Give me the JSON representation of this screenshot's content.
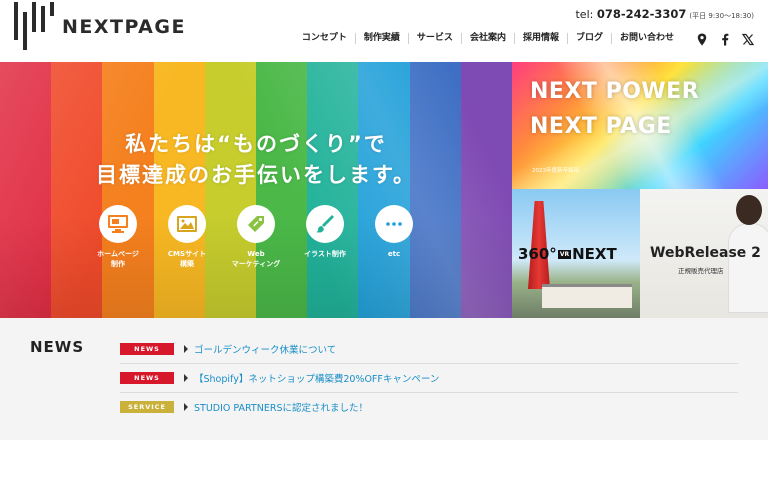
{
  "header": {
    "logo_text": "NEXTPAGE",
    "tel_prefix": "tel: ",
    "tel_number": "078-242-3307",
    "tel_hours": "(平日 9:30〜18:30)",
    "nav": [
      {
        "label": "コンセプト"
      },
      {
        "label": "制作実績"
      },
      {
        "label": "サービス"
      },
      {
        "label": "会社案内"
      },
      {
        "label": "採用情報"
      },
      {
        "label": "ブログ"
      },
      {
        "label": "お問い合わせ"
      }
    ],
    "icons": [
      "map-pin-icon",
      "facebook-icon",
      "x-icon"
    ]
  },
  "hero": {
    "title_line1": "私たちは“ものづくり”で",
    "title_line2": "目標達成のお手伝いをします。",
    "stripe_colors": [
      "#e0293f",
      "#f04a2a",
      "#f5801e",
      "#f8b823",
      "#c6cd2d",
      "#4bb848",
      "#21b29a",
      "#1f9fd8",
      "#3f6fc4",
      "#7e4ab3"
    ],
    "services": [
      {
        "line1": "ホームページ",
        "line2": "制作",
        "icon": "monitor-icon"
      },
      {
        "line1": "CMSサイト",
        "line2": "構築",
        "icon": "image-window-icon"
      },
      {
        "line1": "Web",
        "line2": "マーケティング",
        "icon": "price-tag-icon"
      },
      {
        "line1": "イラスト制作",
        "line2": "",
        "icon": "brush-icon"
      },
      {
        "line1": "etc",
        "line2": "",
        "icon": "ellipsis-icon"
      }
    ]
  },
  "panels": {
    "top": {
      "line1": "NEXT POWER",
      "line2": "NEXT PAGE",
      "small": "2023年度新卒採用"
    },
    "bottom_left": {
      "prefix": "360°",
      "vr": "VR",
      "suffix": "NEXT"
    },
    "bottom_right": {
      "title": "WebRelease 2",
      "sub": "正規販売代理店"
    }
  },
  "news": {
    "title": "NEWS",
    "items": [
      {
        "tag": "NEWS",
        "tag_color": "#d7182a",
        "text": "ゴールデンウィーク休業について"
      },
      {
        "tag": "NEWS",
        "tag_color": "#d7182a",
        "text": "【Shopify】ネットショップ構築費20%OFFキャンペーン"
      },
      {
        "tag": "SERVICE",
        "tag_color": "#c9b13a",
        "text": "STUDIO PARTNERSに認定されました！"
      }
    ]
  }
}
